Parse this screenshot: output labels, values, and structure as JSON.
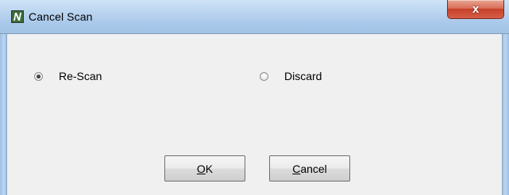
{
  "window": {
    "title": "Cancel Scan",
    "close_glyph": "x",
    "app_icon": "app-icon-n"
  },
  "options": [
    {
      "label": "Re-Scan",
      "checked": true
    },
    {
      "label": "Discard",
      "checked": false
    }
  ],
  "buttons": {
    "ok": {
      "mnemonic": "O",
      "rest": "K"
    },
    "cancel": {
      "mnemonic": "C",
      "rest": "ancel"
    }
  }
}
